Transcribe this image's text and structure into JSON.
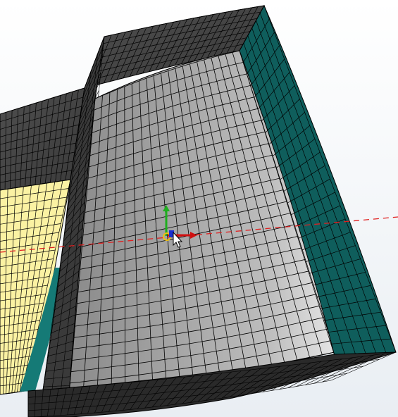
{
  "viewport": {
    "background_top": "#ffffff",
    "background_bottom": "#e9eef3"
  },
  "model": {
    "colors": {
      "top_surface": "#4f4f4f",
      "top_surface_dark": "#3a3a3a",
      "curved_face": "#8a8a8a",
      "curved_face_light": "#bdbdbd",
      "curved_face_highlight": "#e4e4e4",
      "side_face": "#0f5e5c",
      "side_face_dark": "#0a4a48",
      "left_face": "#fbf2a3",
      "left_teal_strip": "#157a76",
      "bottom_band": "#2a2a2a",
      "mesh_lines": "#000000"
    }
  },
  "axis_line": {
    "color": "#e02020",
    "style": "dashed"
  },
  "triad": {
    "x_axis_color": "#d01010",
    "y_axis_color": "#1fae1f",
    "z_axis_color": "#1a2fd0",
    "origin_ring_color": "#f0c010"
  },
  "cursor": {
    "icon": "arrow-pointer-icon"
  }
}
